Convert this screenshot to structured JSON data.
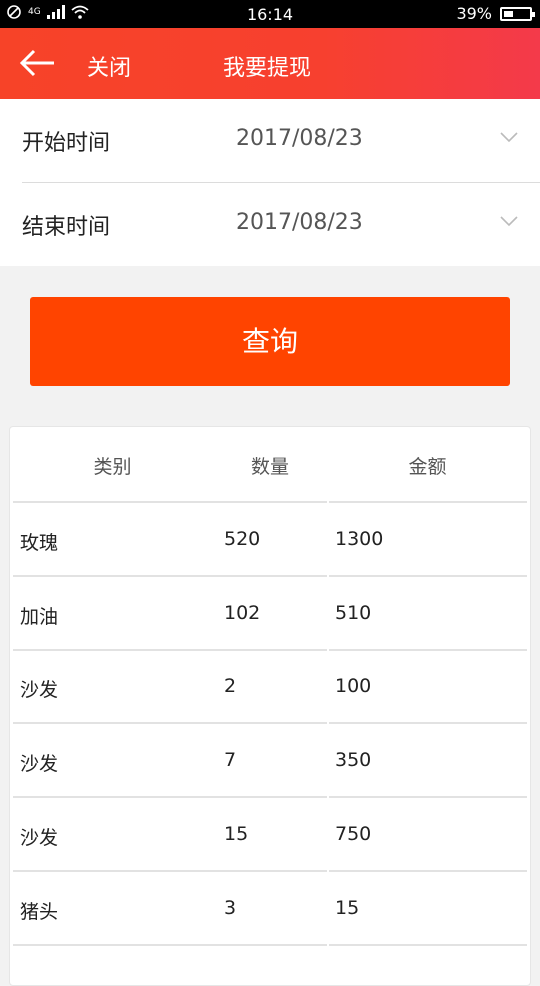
{
  "status_bar": {
    "network_label": "4G",
    "time": "16:14",
    "battery": "39%",
    "battery_level": 0.39
  },
  "header": {
    "back_icon": "arrow-left-icon",
    "close_label": "关闭",
    "title": "我要提现"
  },
  "filters": {
    "start": {
      "label": "开始时间",
      "value": "2017/08/23"
    },
    "end": {
      "label": "结束时间",
      "value": "2017/08/23"
    }
  },
  "query_button": {
    "label": "查询"
  },
  "table": {
    "headers": [
      "类别",
      "数量",
      "金额"
    ],
    "rows": [
      [
        "玫瑰",
        "520",
        "1300"
      ],
      [
        "加油",
        "102",
        "510"
      ],
      [
        "沙发",
        "2",
        "100"
      ],
      [
        "沙发",
        "7",
        "350"
      ],
      [
        "沙发",
        "15",
        "750"
      ],
      [
        "猪头",
        "3",
        "15"
      ]
    ]
  },
  "colors": {
    "header_gradient_start": "#f74328",
    "header_gradient_end": "#f43a4a",
    "query_button": "#ff4400"
  }
}
